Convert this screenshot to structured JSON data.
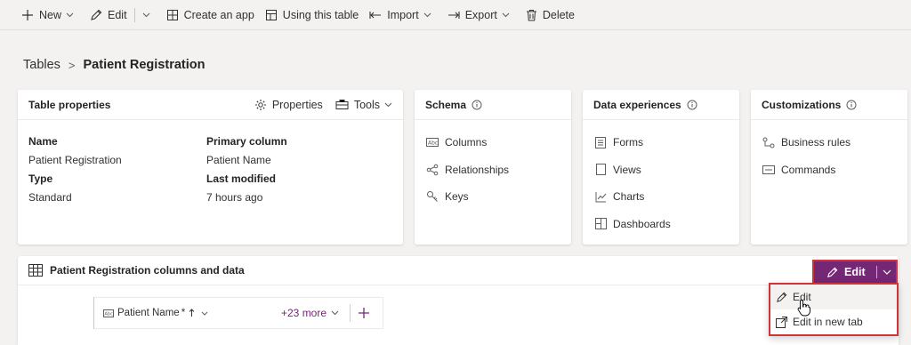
{
  "command_bar": {
    "new": "New",
    "edit": "Edit",
    "create_app": "Create an app",
    "using_table": "Using this table",
    "import": "Import",
    "export": "Export",
    "delete": "Delete"
  },
  "breadcrumb": {
    "root": "Tables",
    "separator": ">",
    "current": "Patient Registration"
  },
  "table_properties": {
    "title": "Table properties",
    "properties_btn": "Properties",
    "tools_btn": "Tools",
    "name_label": "Name",
    "name_value": "Patient Registration",
    "type_label": "Type",
    "type_value": "Standard",
    "primary_column_label": "Primary column",
    "primary_column_value": "Patient Name",
    "last_modified_label": "Last modified",
    "last_modified_value": "7 hours ago"
  },
  "schema": {
    "title": "Schema",
    "items": [
      "Columns",
      "Relationships",
      "Keys"
    ]
  },
  "data_experiences": {
    "title": "Data experiences",
    "items": [
      "Forms",
      "Views",
      "Charts",
      "Dashboards"
    ]
  },
  "customizations": {
    "title": "Customizations",
    "items": [
      "Business rules",
      "Commands"
    ]
  },
  "columns_panel": {
    "title": "Patient Registration columns and data",
    "column_header": "Patient Name",
    "required_marker": "*",
    "more_columns": "+23 more"
  },
  "edit_button": {
    "label": "Edit"
  },
  "edit_menu": {
    "items": [
      "Edit",
      "Edit in new tab"
    ]
  },
  "colors": {
    "accent": "#742774",
    "highlight_border": "#d13438"
  }
}
